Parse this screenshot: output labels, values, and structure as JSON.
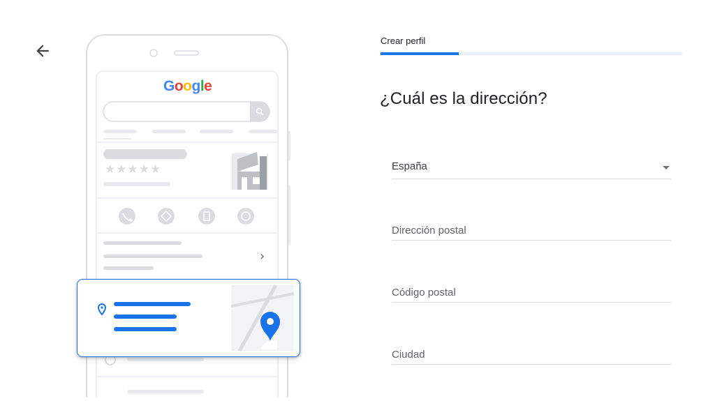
{
  "header": {
    "back_icon": "arrow-back-icon",
    "step_label": "Crear perfil",
    "progress": 0.26
  },
  "main": {
    "heading": "¿Cuál es la dirección?",
    "fields": {
      "country_value": "España",
      "address_placeholder": "Dirección postal",
      "postal_placeholder": "Código postal",
      "city_placeholder": "Ciudad"
    }
  },
  "illustration": {
    "logo_letters": [
      "G",
      "o",
      "o",
      "g",
      "l",
      "e"
    ],
    "logo_colors": [
      "#4285f4",
      "#ea4335",
      "#fbbc05",
      "#4285f4",
      "#34a853",
      "#ea4335"
    ],
    "stars": "★★★★★",
    "chevron": "›",
    "accent": "#1a73e8"
  }
}
